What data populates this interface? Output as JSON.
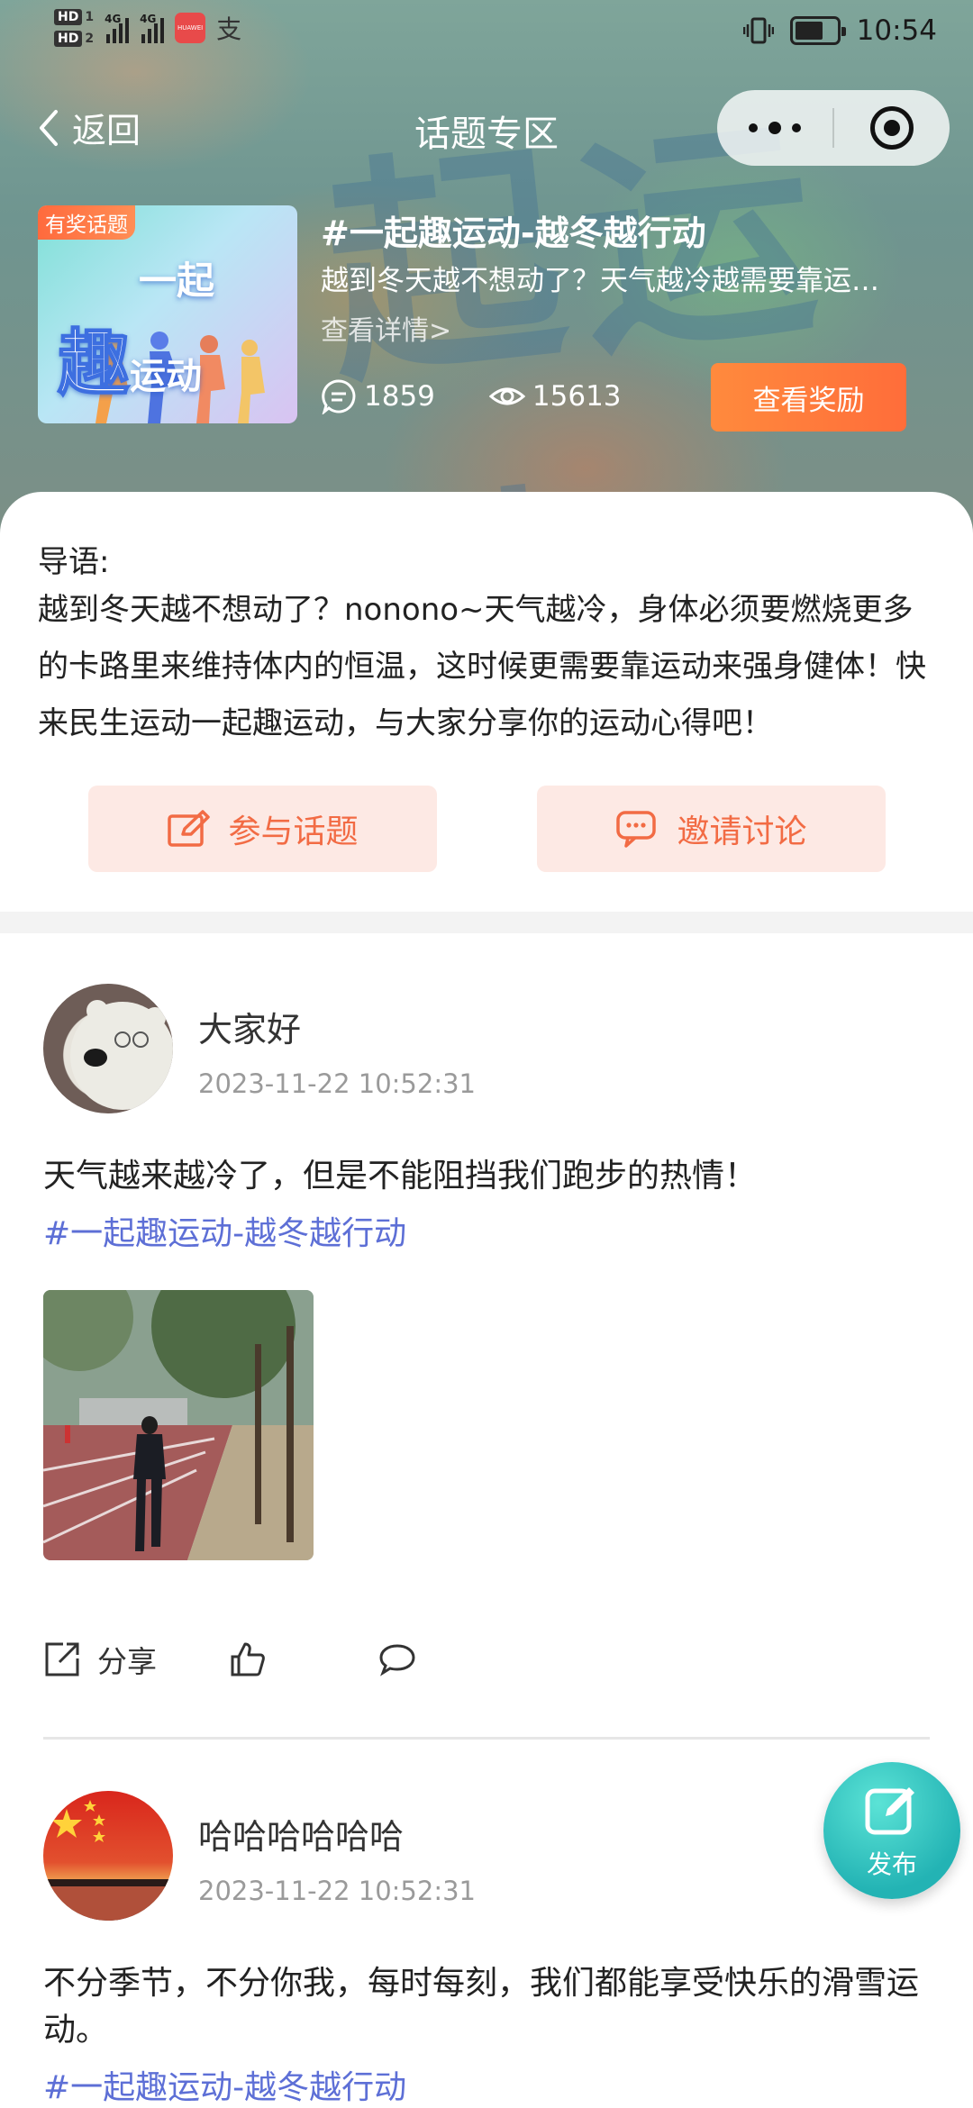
{
  "status_bar": {
    "sim1": "HD",
    "sim1_num": "1",
    "sim2": "HD",
    "sim2_num": "2",
    "net1": "4G",
    "net2": "4G",
    "clock": "10:54"
  },
  "nav": {
    "back_label": "返回",
    "title": "话题专区"
  },
  "topic": {
    "badge": "有奖话题",
    "cover_text_1": "一起",
    "cover_text_2": "趣",
    "cover_text_3": "运动",
    "title": "#一起趣运动-越冬越行动",
    "description": "越到冬天越不想动了？天气越冷越需要靠运动来强身健体",
    "detail_link": "查看详情>",
    "comments_count": "1859",
    "views_count": "15613",
    "reward_button": "查看奖励"
  },
  "intro": {
    "label": "导语:",
    "text": "越到冬天越不想动了？nonono~天气越冷，身体必须要燃烧更多的卡路里来维持体内的恒温，这时候更需要靠运动来强身健体！快来民生运动一起趣运动，与大家分享你的运动心得吧！",
    "join_button": "参与话题",
    "invite_button": "邀请讨论"
  },
  "posts": [
    {
      "user": "大家好",
      "time": "2023-11-22 10:52:31",
      "text": "天气越来越冷了，但是不能阻挡我们跑步的热情！",
      "tag": "#一起趣运动-越冬越行动",
      "share_label": "分享"
    },
    {
      "user": "哈哈哈哈哈哈",
      "time": "2023-11-22 10:52:31",
      "text": "不分季节，不分你我，每时每刻，我们都能享受快乐的滑雪运动。",
      "tag": "#一起趣运动-越冬越行动"
    }
  ],
  "fab": {
    "label": "发布"
  },
  "colors": {
    "accent_orange": "#ff7a3c",
    "tag_blue": "#5d6fd6",
    "fab_teal": "#23b3b4",
    "button_bg": "#fde9e4"
  }
}
